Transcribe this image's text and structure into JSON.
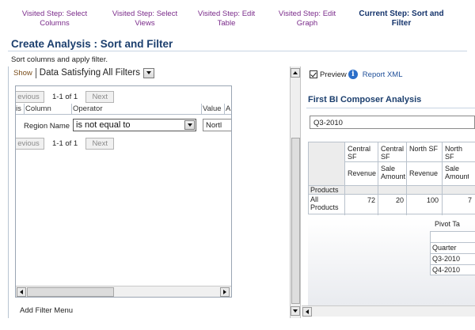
{
  "train": {
    "steps": [
      {
        "label_1": "Visited Step: Select",
        "label_2": "Columns"
      },
      {
        "label_1": "Visited Step: Select",
        "label_2": "Views"
      },
      {
        "label_1": "Visited Step: Edit",
        "label_2": "Table"
      },
      {
        "label_1": "Visited Step: Edit",
        "label_2": "Graph"
      },
      {
        "label_1": "Current Step: Sort and",
        "label_2": "Filter"
      }
    ]
  },
  "page": {
    "title": "Create Analysis : Sort and Filter",
    "subtitle": "Sort columns and apply filter."
  },
  "filter_panel": {
    "show_label": "Show",
    "show_value": "Data Satisfying All Filters",
    "pager": {
      "prev_label": "evious",
      "range": "1-1 of 1",
      "next_label": "Next"
    },
    "columns": {
      "col0": "is",
      "column": "Column",
      "operator": "Operator",
      "value": "Value",
      "extra": "A"
    },
    "row": {
      "column": "Region Name",
      "operator": "is not equal to",
      "value": "Nortl"
    },
    "add_filter_menu": "Add Filter Menu"
  },
  "preview_panel": {
    "preview_label": "Preview",
    "report_xml": "Report XML",
    "title": "First BI Composer Analysis",
    "selected_quarter": "Q3-2010",
    "pivot": {
      "col_headers": [
        "Central SF",
        "Central SF",
        "North SF",
        "North SF"
      ],
      "measure_headers": [
        "Revenue",
        "Sale Amount",
        "Revenue",
        "Sale Amount"
      ],
      "row_header": "Products",
      "row_label": "All Products",
      "values": [
        "72",
        "20",
        "100",
        "7"
      ]
    },
    "pivot_table_label": "Pivot Ta",
    "quarter_header": "Quarter",
    "quarters": [
      "Q3-2010",
      "Q4-2010"
    ]
  },
  "colors": {
    "visited_step": "#7a2b8a",
    "current_step": "#14336b",
    "title": "#1c3f6e",
    "link": "#1f4f99"
  }
}
